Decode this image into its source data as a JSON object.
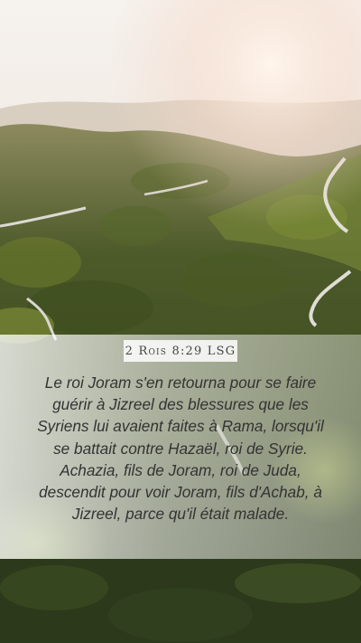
{
  "reference": "2 Rois 8:29 LSG",
  "verse_text": "Le roi Joram s'en retourna pour se faire guérir à Jizreel des blessures que les Syriens lui avaient faites à Rama, lorsqu'il se battait contre Hazaël, roi de Syrie. Achazia, fils de Joram, roi de Juda, descendit pour voir Joram, fils d'Achab, à Jizreel, parce qu'il était malade.",
  "colors": {
    "sky": "#f4efe9",
    "forest_dark": "#2a3618",
    "forest_light": "#7a8a3a",
    "road": "#d8d6d0",
    "text": "#333333"
  }
}
